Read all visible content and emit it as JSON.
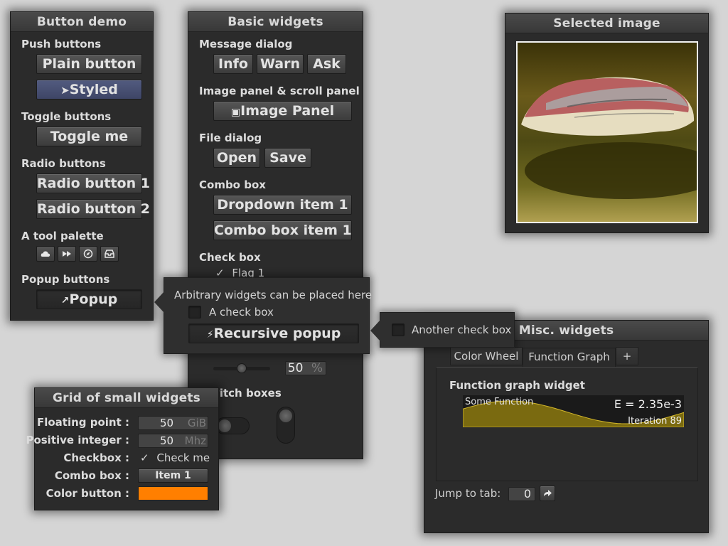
{
  "button_demo": {
    "title": "Button demo",
    "push_label": "Push buttons",
    "plain_button": "Plain button",
    "styled_button": "Styled",
    "toggle_label": "Toggle buttons",
    "toggle_button": "Toggle me",
    "radio_label": "Radio buttons",
    "radio_1": "Radio button 1",
    "radio_2": "Radio button 2",
    "palette_label": "A tool palette",
    "palette_icons": [
      "cloud-icon",
      "fast-forward-icon",
      "compass-icon",
      "inbox-icon"
    ],
    "popup_label": "Popup buttons",
    "popup_button": "Popup"
  },
  "popup": {
    "text": "Arbitrary widgets can be placed here",
    "checkbox_label": "A check box",
    "recursive_button": "Recursive popup",
    "nested_checkbox_label": "Another check box"
  },
  "basic_widgets": {
    "title": "Basic widgets",
    "message_label": "Message dialog",
    "info": "Info",
    "warn": "Warn",
    "ask": "Ask",
    "image_panel_label": "Image panel & scroll panel",
    "image_panel_button": "Image Panel",
    "file_label": "File dialog",
    "open": "Open",
    "save": "Save",
    "combo_label": "Combo box",
    "dropdown": "Dropdown item 1",
    "combo": "Combo box item 1",
    "checkbox_label": "Check box",
    "flag": "Flag 1",
    "slider_value": "50",
    "slider_unit": "%",
    "slider_fraction": 0.5,
    "switch_label": "witch boxes"
  },
  "selected_image": {
    "title": "Selected image"
  },
  "grid": {
    "title": "Grid of small widgets",
    "float_label": "Floating point :",
    "float_value": "50",
    "float_unit": "GiB",
    "int_label": "Positive integer :",
    "int_value": "50",
    "int_unit": "Mhz",
    "checkbox_label": "Checkbox :",
    "checkbox_text": "Check me",
    "combo_label": "Combo box :",
    "combo_value": "Item 1",
    "color_label": "Color button :",
    "color_value": "#ff7f00"
  },
  "misc": {
    "title": "Misc. widgets",
    "tabs": [
      "Color Wheel",
      "Function Graph",
      "+"
    ],
    "graph_title": "Function graph widget",
    "graph_caption": "Some Function",
    "graph_header": "E = 2.35e-3",
    "graph_footer": "Iteration 89",
    "jump_label": "Jump to tab:",
    "jump_value": "0"
  },
  "colors": {
    "background": "#d5d5d5",
    "window": "#2b2b2b",
    "graph_fill": "#7a6a10",
    "graph_line": "#d4b82a",
    "styled_button": "#525b80"
  }
}
